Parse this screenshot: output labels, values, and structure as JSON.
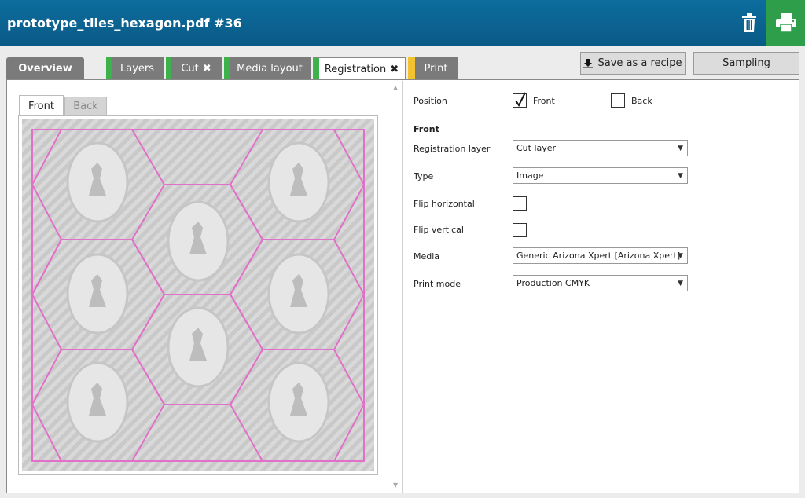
{
  "header": {
    "title": "prototype_tiles_hexagon.pdf #36"
  },
  "tabs": {
    "overview": "Overview",
    "layers": "Layers",
    "cut": "Cut",
    "media_layout": "Media layout",
    "registration": "Registration",
    "print": "Print"
  },
  "toolbar": {
    "save_recipe": "Save as a recipe",
    "sampling": "Sampling"
  },
  "preview": {
    "front_tab": "Front",
    "back_tab": "Back"
  },
  "form": {
    "position_label": "Position",
    "front_option": "Front",
    "back_option": "Back",
    "front_checked": true,
    "back_checked": false,
    "section_title": "Front",
    "registration_layer_label": "Registration layer",
    "registration_layer_value": "Cut layer",
    "type_label": "Type",
    "type_value": "Image",
    "flip_h_label": "Flip horizontal",
    "flip_v_label": "Flip vertical",
    "media_label": "Media",
    "media_value": "Generic Arizona Xpert [Arizona Xpert]",
    "print_mode_label": "Print mode",
    "print_mode_value": "Production CMYK"
  },
  "colors": {
    "header": "#0a5f8d",
    "green": "#3db14c",
    "yellow": "#f2c230",
    "cut_line": "#e070c8"
  }
}
